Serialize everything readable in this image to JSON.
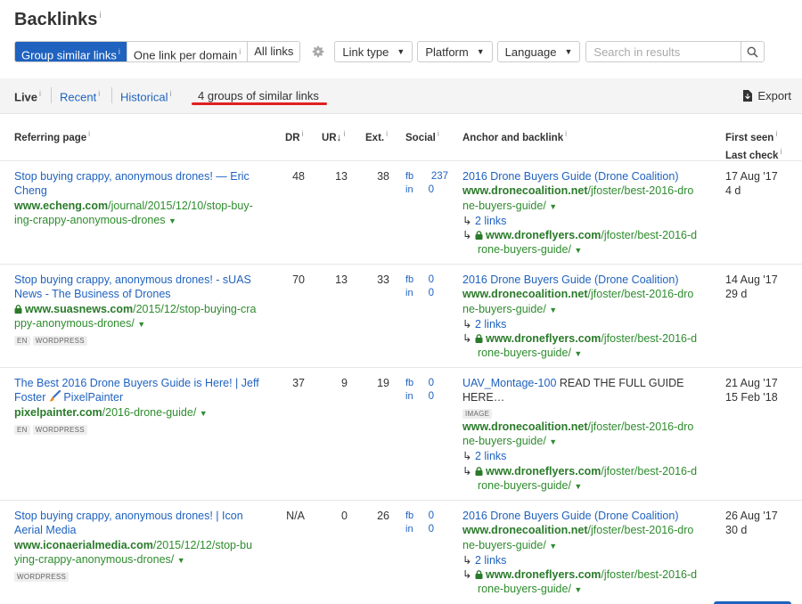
{
  "page": {
    "title": "Backlinks",
    "title_info": "i"
  },
  "toolbar": {
    "group_similar": "Group similar links",
    "one_per_domain": "One link per domain",
    "all_links": "All links",
    "info": "i",
    "link_type": "Link type",
    "platform": "Platform",
    "language": "Language",
    "search_placeholder": "Search in results"
  },
  "tabs": {
    "live": "Live",
    "recent": "Recent",
    "historical": "Historical",
    "groups": "4 groups of similar links",
    "export": "Export",
    "info": "i"
  },
  "columns": {
    "referring_page": "Referring page",
    "dr": "DR",
    "ur": "UR",
    "ur_sort": "↓",
    "ext": "Ext.",
    "social": "Social",
    "anchor": "Anchor and backlink",
    "first_seen": "First seen",
    "last_check": "Last check",
    "info": "i"
  },
  "rows": [
    {
      "title1": "Stop buying crappy, anonymous drones! — Eric",
      "title2": "Cheng",
      "url_domain": "www.echeng.com",
      "url_path1": "/journal/2015/12/10/stop-buy-",
      "url_path2": "ing-crappy-anonymous-drones",
      "dr": "48",
      "ur": "13",
      "ext": "38",
      "fb": "fb",
      "fb_n": "237",
      "in": "in",
      "in_n": "0",
      "anchor": "2016 Drone Buyers Guide (Drone Coalition)",
      "bl_domain": "www.dronecoalition.net",
      "bl_path": "/jfoster/best-2016-dro",
      "bl_path2": "ne-buyers-guide/",
      "links": "2 links",
      "bl2_domain": "www.droneflyers.com",
      "bl2_path": "/jfoster/best-2016-d",
      "bl2_path2": "rone-buyers-guide/",
      "first_seen": "17 Aug '17",
      "last_check": "4 d"
    },
    {
      "title1": "Stop buying crappy, anonymous drones! - sUAS",
      "title2": "News - The Business of Drones",
      "url_domain": "www.suasnews.com",
      "url_path1": "/2015/12/stop-buying-cra",
      "url_path2": "ppy-anonymous-drones/",
      "tags": [
        "EN",
        "WORDPRESS"
      ],
      "dr": "70",
      "ur": "13",
      "ext": "33",
      "fb": "fb",
      "fb_n": "0",
      "in": "in",
      "in_n": "0",
      "anchor": "2016 Drone Buyers Guide (Drone Coalition)",
      "bl_domain": "www.dronecoalition.net",
      "bl_path": "/jfoster/best-2016-dro",
      "bl_path2": "ne-buyers-guide/",
      "links": "2 links",
      "bl2_domain": "www.droneflyers.com",
      "bl2_path": "/jfoster/best-2016-d",
      "bl2_path2": "rone-buyers-guide/",
      "first_seen": "14 Aug '17",
      "last_check": "29 d"
    },
    {
      "title1": "The Best 2016 Drone Buyers Guide is Here! | Jeff",
      "title2": "Foster",
      "title2b": "PixelPainter",
      "url_domain": "pixelpainter.com",
      "url_path1": "/2016-drone-guide/",
      "tags": [
        "EN",
        "WORDPRESS"
      ],
      "dr": "37",
      "ur": "9",
      "ext": "19",
      "fb": "fb",
      "fb_n": "0",
      "in": "in",
      "in_n": "0",
      "anchor_link": "UAV_Montage-100",
      "anchor_text1": " READ THE FULL GUIDE",
      "anchor_text2": "HERE…",
      "image_tag": "IMAGE",
      "bl_domain": "www.dronecoalition.net",
      "bl_path": "/jfoster/best-2016-dro",
      "bl_path2": "ne-buyers-guide/",
      "links": "2 links",
      "bl2_domain": "www.droneflyers.com",
      "bl2_path": "/jfoster/best-2016-d",
      "bl2_path2": "rone-buyers-guide/",
      "first_seen": "21 Aug '17",
      "last_check": "15 Feb '18"
    },
    {
      "title1": "Stop buying crappy, anonymous drones! | Icon",
      "title2": "Aerial Media",
      "url_domain": "www.iconaerialmedia.com",
      "url_path1": "/2015/12/12/stop-bu",
      "url_path2": "ying-crappy-anonymous-drones/",
      "tags": [
        "WORDPRESS"
      ],
      "dr": "N/A",
      "ur": "0",
      "ext": "26",
      "fb": "fb",
      "fb_n": "0",
      "in": "in",
      "in_n": "0",
      "anchor": "2016 Drone Buyers Guide (Drone Coalition)",
      "bl_domain": "www.dronecoalition.net",
      "bl_path": "/jfoster/best-2016-dro",
      "bl_path2": "ne-buyers-guide/",
      "links": "2 links",
      "bl2_domain": "www.droneflyers.com",
      "bl2_path": "/jfoster/best-2016-d",
      "bl2_path2": "rone-buyers-guide/",
      "first_seen": "26 Aug '17",
      "last_check": "30 d"
    }
  ],
  "glyphs": {
    "caret": "▼",
    "arrow": "↳"
  },
  "colors": {
    "accent": "#1f62bf",
    "url_green": "#2e8c2e",
    "underline_red": "#e02020"
  }
}
